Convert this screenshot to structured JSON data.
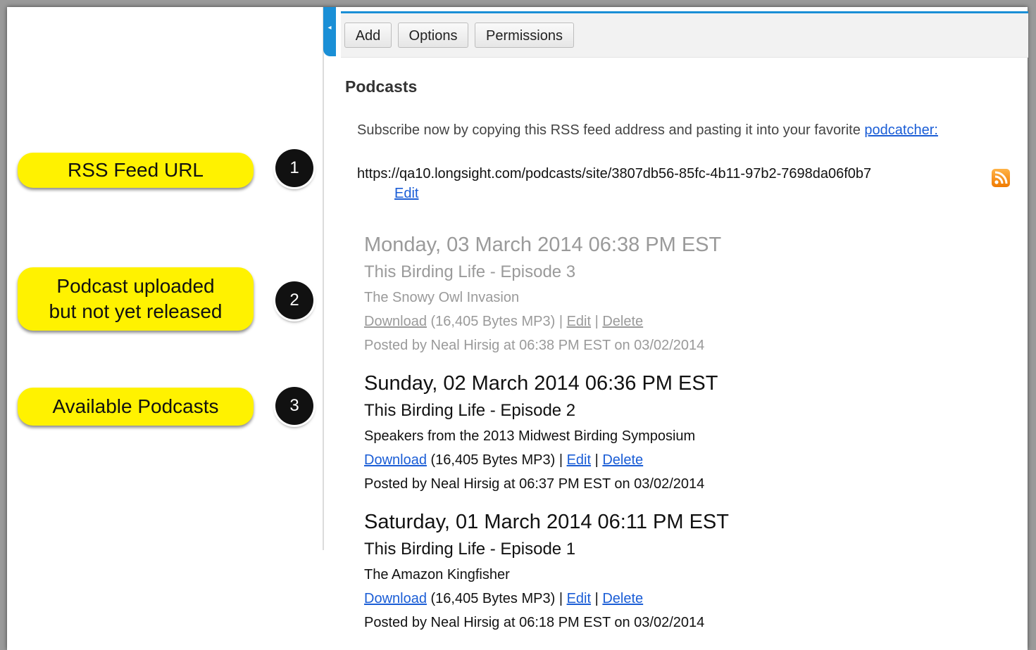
{
  "callouts": [
    {
      "number": "1",
      "text": "RSS Feed URL"
    },
    {
      "number": "2",
      "line1": "Podcast uploaded",
      "line2": "but not yet released"
    },
    {
      "number": "3",
      "text": "Available Podcasts"
    }
  ],
  "toolbar": {
    "add": "Add",
    "options": "Options",
    "permissions": "Permissions"
  },
  "collapse_glyph": "◂",
  "page": {
    "title": "Podcasts",
    "subscribe_text": "Subscribe now by copying this RSS feed address and pasting it into your favorite ",
    "subscribe_link": "podcatcher:",
    "feed_url": "https://qa10.longsight.com/podcasts/site/3807db56-85fc-4b11-97b2-7698da06f0b7",
    "feed_edit": "Edit",
    "rss_icon": "rss-feed-icon"
  },
  "episodes": [
    {
      "date": "Monday, 03 March 2014 06:38 PM EST",
      "title": "This Birding Life - Episode 3",
      "description": "The Snowy Owl Invasion",
      "download": "Download",
      "size": " (16,405 Bytes MP3) | ",
      "edit": "Edit",
      "sep": " | ",
      "delete": "Delete",
      "posted": "Posted by Neal Hirsig at 06:38 PM EST on 03/02/2014",
      "released": false
    },
    {
      "date": "Sunday, 02 March 2014 06:36 PM EST",
      "title": "This Birding Life - Episode 2",
      "description": "Speakers from the 2013 Midwest Birding Symposium",
      "download": "Download",
      "size": " (16,405 Bytes MP3) | ",
      "edit": "Edit",
      "sep": " | ",
      "delete": "Delete",
      "posted": "Posted by Neal Hirsig at 06:37 PM EST on 03/02/2014",
      "released": true
    },
    {
      "date": "Saturday, 01 March 2014 06:11 PM EST",
      "title": "This Birding Life - Episode 1",
      "description": "The Amazon Kingfisher",
      "download": "Download",
      "size": " (16,405 Bytes MP3) | ",
      "edit": "Edit",
      "sep": " | ",
      "delete": "Delete",
      "posted": "Posted by Neal Hirsig at 06:18 PM EST on 03/02/2014",
      "released": true
    }
  ],
  "colors": {
    "accent": "#1a8fd6",
    "callout": "#fff200",
    "link": "#1a5dd6",
    "unreleased": "#9a9a9a"
  }
}
